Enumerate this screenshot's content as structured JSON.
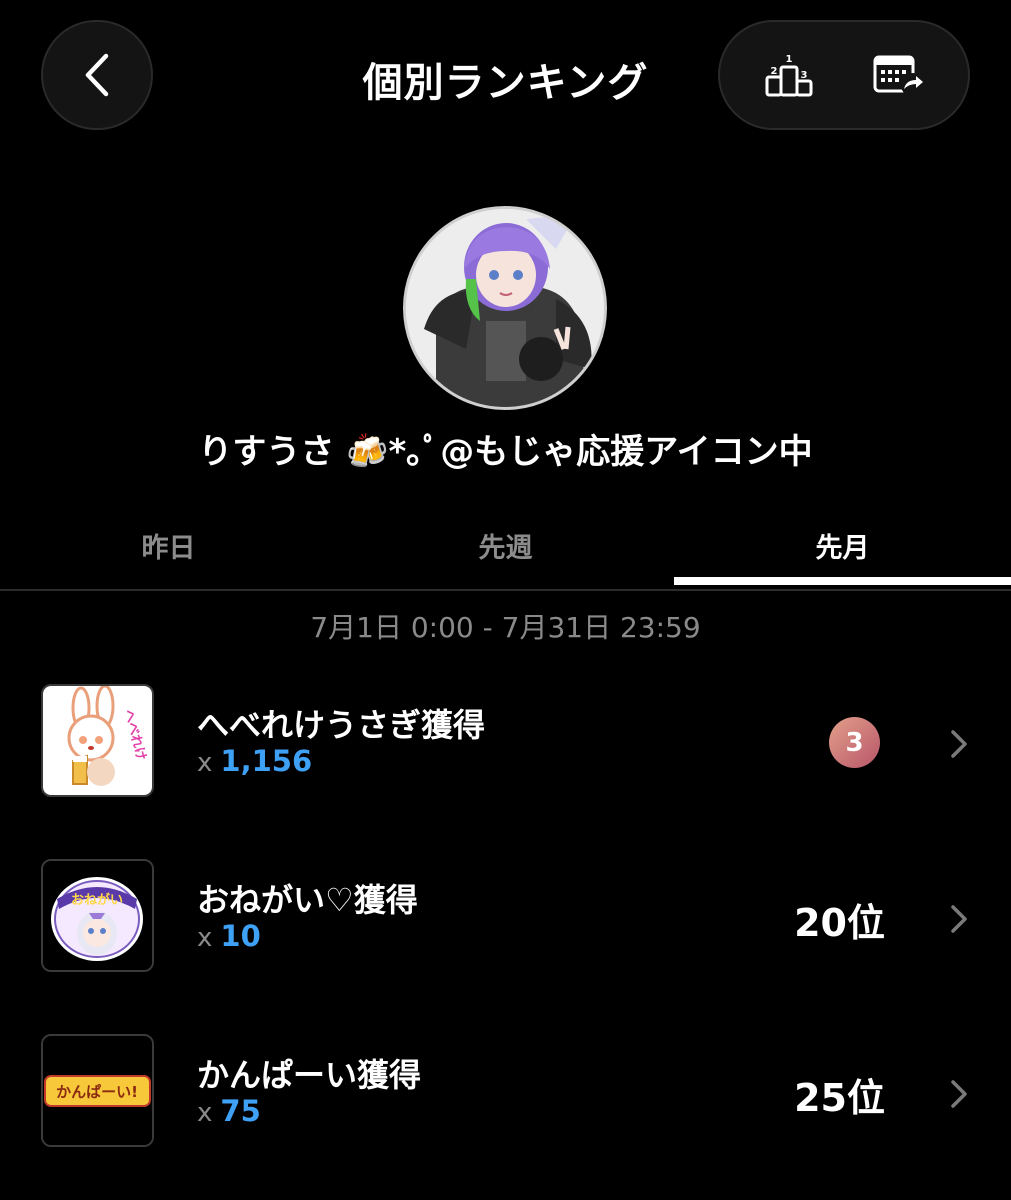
{
  "header": {
    "title": "個別ランキング",
    "back_icon": "chevron-left-icon",
    "podium_icon": "podium-icon",
    "podium_numbers": [
      "1",
      "2",
      "3"
    ],
    "calendar_icon": "calendar-forward-icon"
  },
  "profile": {
    "username": "りすうさ 🍻*｡ﾟ@もじゃ応援アイコン中"
  },
  "tabs": [
    {
      "label": "昨日",
      "active": false
    },
    {
      "label": "先週",
      "active": false
    },
    {
      "label": "先月",
      "active": true
    }
  ],
  "date_range": "7月1日 0:00 - 7月31日 23:59",
  "items": [
    {
      "name": "へべれけうさぎ獲得",
      "count_prefix": "x",
      "count": "1,156",
      "rank": "3",
      "rank_style": "badge",
      "thumb_icon": "drunk-bunny-sticker-icon",
      "thumb_text": "へべれけ"
    },
    {
      "name": "おねがい♡獲得",
      "count_prefix": "x",
      "count": "10",
      "rank": "20位",
      "rank_style": "text",
      "thumb_icon": "onegai-sticker-icon",
      "thumb_text": "おねがい"
    },
    {
      "name": "かんぱーい獲得",
      "count_prefix": "x",
      "count": "75",
      "rank": "25位",
      "rank_style": "text",
      "thumb_icon": "kanpai-sticker-icon",
      "thumb_text": "かんぱーい!"
    }
  ],
  "colors": {
    "background": "#000000",
    "accent_blue": "#3ea1f5",
    "muted_text": "#8a8a8a",
    "badge_gradient_start": "#e2a08a",
    "badge_gradient_end": "#b8556a"
  }
}
